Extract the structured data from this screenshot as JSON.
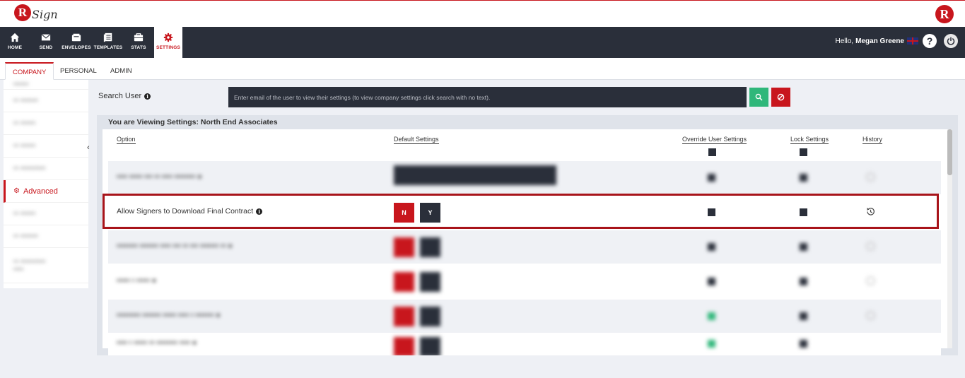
{
  "brand": {
    "logo_letter": "R",
    "logo_text": "Sign",
    "accent_color": "#c8161d",
    "nav_bg_color": "#2a2f3a"
  },
  "nav": {
    "items": [
      {
        "label": "HOME",
        "icon": "home-icon"
      },
      {
        "label": "SEND",
        "icon": "mail-icon"
      },
      {
        "label": "ENVELOPES",
        "icon": "envelope-icon"
      },
      {
        "label": "TEMPLATES",
        "icon": "template-icon"
      },
      {
        "label": "STATS",
        "icon": "briefcase-icon"
      },
      {
        "label": "SETTINGS",
        "icon": "gear-icon",
        "active": true
      }
    ],
    "greeting": "Hello,",
    "user_name": "Megan Greene",
    "help_label": "?"
  },
  "tabs": [
    {
      "label": "COMPANY",
      "active": true
    },
    {
      "label": "PERSONAL"
    },
    {
      "label": "ADMIN"
    }
  ],
  "sidebar": {
    "active_item": "Advanced",
    "collapse_symbol": "‹"
  },
  "search": {
    "label": "Search User",
    "placeholder": "Enter email of the user to view their settings (to view company settings click search with no text)."
  },
  "panel": {
    "title": "You are Viewing Settings: North End Associates",
    "columns": {
      "option": "Option",
      "default": "Default Settings",
      "override": "Override User Settings",
      "lock": "Lock Settings",
      "history": "History"
    },
    "highlighted_row": {
      "label": "Allow Signers to Download Final Contract",
      "no_label": "N",
      "yes_label": "Y"
    }
  }
}
